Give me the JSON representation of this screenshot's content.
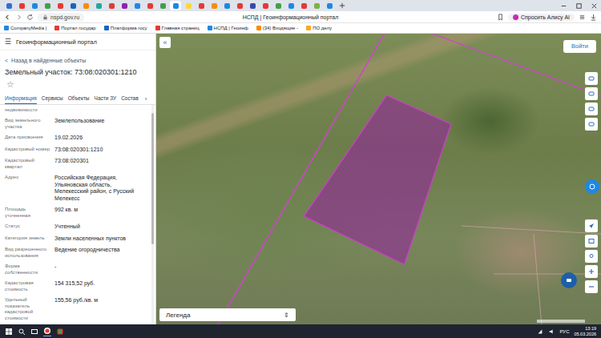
{
  "browser": {
    "tabs": [
      {
        "color": "#2f6fd6",
        "selected": false
      },
      {
        "color": "#e53935",
        "selected": false
      },
      {
        "color": "#1e88e5",
        "selected": false
      },
      {
        "color": "#43a047",
        "selected": false
      },
      {
        "color": "#e53935",
        "selected": false
      },
      {
        "color": "#1565c0",
        "selected": false
      },
      {
        "color": "#fb8c00",
        "selected": false
      },
      {
        "color": "#26a69a",
        "selected": false
      },
      {
        "color": "#e53935",
        "selected": false
      },
      {
        "color": "#8e24aa",
        "selected": false
      },
      {
        "color": "#1e88e5",
        "selected": false
      },
      {
        "color": "#e53935",
        "selected": false
      },
      {
        "color": "#43a047",
        "selected": false
      },
      {
        "color": "#1e88e5",
        "selected": true
      },
      {
        "color": "#fdd835",
        "selected": false
      },
      {
        "color": "#e53935",
        "selected": false
      },
      {
        "color": "#fb8c00",
        "selected": false
      },
      {
        "color": "#1e88e5",
        "selected": false
      },
      {
        "color": "#e53935",
        "selected": false
      },
      {
        "color": "#3949ab",
        "selected": false
      },
      {
        "color": "#e53935",
        "selected": false
      },
      {
        "color": "#43a047",
        "selected": false
      },
      {
        "color": "#1e88e5",
        "selected": false
      },
      {
        "color": "#e53935",
        "selected": false
      },
      {
        "color": "#7cb342",
        "selected": false
      },
      {
        "color": "#1e88e5",
        "selected": false
      }
    ],
    "address": "nspd.gov.ru",
    "page_title": "НСПД | Геоинформационный портал",
    "alice": "Спросить Алису AI",
    "bookmarks": [
      {
        "label": "CompanyMedia |",
        "color": "#1e88e5"
      },
      {
        "label": "Портал государ",
        "color": "#e53935"
      },
      {
        "label": "Платформа госу",
        "color": "#1565c0"
      },
      {
        "label": "Главная страниц",
        "color": "#e53935"
      },
      {
        "label": "НСПД | Геоинф",
        "color": "#1e88e5"
      },
      {
        "label": "(34) Входящие -",
        "color": "#fb8c00"
      },
      {
        "label": "ПО делу",
        "color": "#f9a825"
      }
    ]
  },
  "portal": {
    "menu_icon": "☰",
    "name": "Геоинформационный портал",
    "back_icon": "<",
    "back": "Назад в найденные объекты",
    "title": "Земельный участок: 73:08:020301:1210",
    "star": "☆",
    "tabs": [
      {
        "label": "Информация",
        "selected": true
      },
      {
        "label": "Сервисы",
        "selected": false
      },
      {
        "label": "Объекты",
        "selected": false
      },
      {
        "label": "Части ЗУ",
        "selected": false
      },
      {
        "label": "Состав",
        "selected": false
      }
    ],
    "tabs_next": "›",
    "cut_label": "недвижимости",
    "fields": [
      {
        "label": "Вид земельного участка",
        "value": "Землепользование"
      },
      {
        "label": "Дата присвоения",
        "value": "19.02.2026"
      },
      {
        "label": "Кадастровый номер",
        "value": "73:08:020301:1210"
      },
      {
        "label": "Кадастровый квартал",
        "value": "73:08:020301"
      },
      {
        "label": "Адрес",
        "value": "Российская Федерация, Ульяновская область, Мелекесский район, с Русский Мелекесс"
      },
      {
        "label": "Площадь уточненная",
        "value": "992 кв. м"
      },
      {
        "label": "Статус",
        "value": "Учтенный"
      },
      {
        "label": "Категория земель",
        "value": "Земли населенных пунктов"
      },
      {
        "label": "Вид разрешенного использования",
        "value": "Ведение огородничества"
      },
      {
        "label": "Форма собственности",
        "value": "-"
      },
      {
        "label": "Кадастровая стоимость",
        "value": "154 315,52 руб."
      },
      {
        "label": "Удельный показатель кадастровой стоимости",
        "value": "155,56 руб./кв. м"
      }
    ]
  },
  "map": {
    "collapse": "«",
    "login": "Войти",
    "legend": "Легенда",
    "legend_icon": "⇕"
  },
  "taskbar": {
    "lang": "РУС",
    "time": "13:19",
    "date": "05.03.2026"
  }
}
